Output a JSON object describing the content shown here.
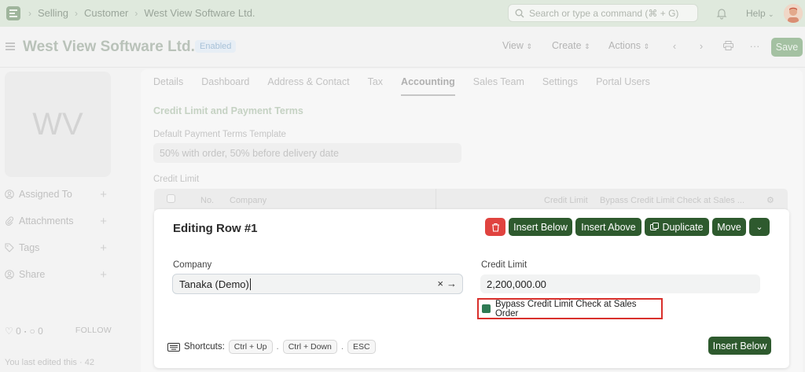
{
  "navbar": {
    "breadcrumbs": [
      "Selling",
      "Customer",
      "West View Software Ltd."
    ],
    "search_placeholder": "Search or type a command (⌘ + G)",
    "help_label": "Help"
  },
  "header": {
    "title": "West View Software Ltd.",
    "status": "Enabled",
    "view_label": "View",
    "create_label": "Create",
    "actions_label": "Actions",
    "save_label": "Save"
  },
  "sidebar": {
    "avatar_initials": "WV",
    "items": [
      {
        "label": "Assigned To"
      },
      {
        "label": "Attachments"
      },
      {
        "label": "Tags"
      },
      {
        "label": "Share"
      }
    ],
    "likes": "0",
    "comments": "0",
    "follow_label": "FOLLOW",
    "last_edited": "You last edited this · 42"
  },
  "tabs": [
    {
      "label": "Details"
    },
    {
      "label": "Dashboard"
    },
    {
      "label": "Address & Contact"
    },
    {
      "label": "Tax"
    },
    {
      "label": "Accounting"
    },
    {
      "label": "Sales Team"
    },
    {
      "label": "Settings"
    },
    {
      "label": "Portal Users"
    }
  ],
  "section": {
    "title": "Credit Limit and Payment Terms",
    "payment_terms_label": "Default Payment Terms Template",
    "payment_terms_value": "50% with order, 50% before delivery date",
    "credit_limit_label": "Credit Limit"
  },
  "grid": {
    "col_no": "No.",
    "col_company": "Company",
    "col_credit": "Credit Limit",
    "col_bypass": "Bypass Credit Limit Check at Sales ..."
  },
  "editor": {
    "title": "Editing Row #1",
    "insert_below": "Insert Below",
    "insert_above": "Insert Above",
    "duplicate": "Duplicate",
    "move": "Move",
    "company_label": "Company",
    "company_value": "Tanaka (Demo)",
    "credit_label": "Credit Limit",
    "credit_value": "2,200,000.00",
    "bypass_label": "Bypass Credit Limit Check at Sales Order",
    "shortcuts_label": "Shortcuts:",
    "shortcut_keys": [
      "Ctrl + Up",
      "Ctrl + Down",
      "ESC"
    ],
    "insert_below_bottom": "Insert Below"
  },
  "colors": {
    "primary_button": "#2e5a2e",
    "danger": "#e0433f",
    "highlight_border": "#d9302c",
    "checkbox": "#2f7a53"
  }
}
